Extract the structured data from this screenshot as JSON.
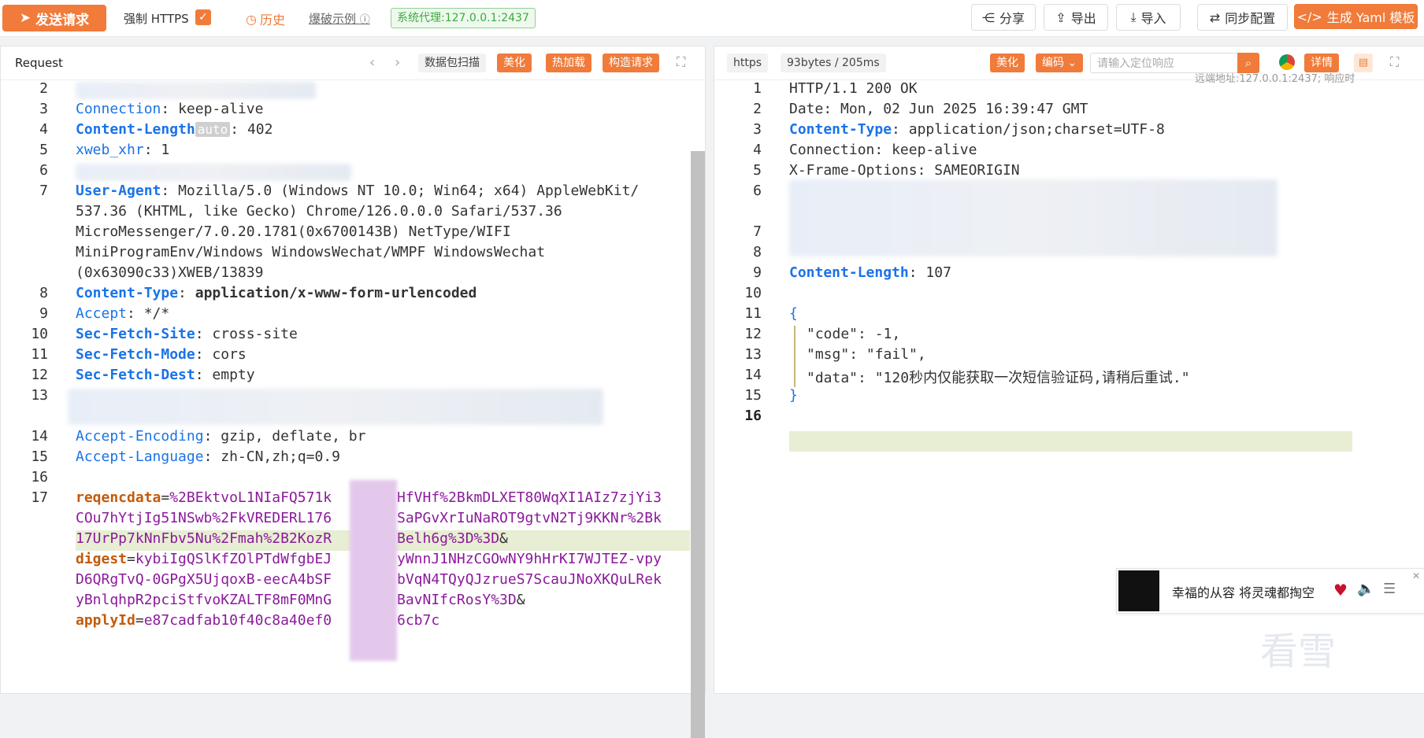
{
  "topbar": {
    "send_label": "发送请求",
    "https_label": "强制 HTTPS",
    "history_label": "历史",
    "example_label": "爆破示例",
    "proxy_label": "系统代理:127.0.0.1:2437",
    "share_label": "分享",
    "export_label": "导出",
    "import_label": "导入",
    "sync_label": "同步配置",
    "yaml_label": "生成 Yaml 模板"
  },
  "request": {
    "title": "Request",
    "scan_label": "数据包扫描",
    "beautify_label": "美化",
    "hotload_label": "热加载",
    "build_label": "构造请求",
    "auto_label": "auto",
    "line_numbers": [
      "2",
      "3",
      "4",
      "5",
      "6",
      "7",
      "8",
      "9",
      "10",
      "11",
      "12",
      "13",
      "14",
      "15",
      "16",
      "17"
    ],
    "headers": {
      "connection_key": "Connection",
      "connection_val": "keep-alive",
      "length_key": "Content-Length",
      "length_val": "402",
      "xhr_key": "xweb_xhr",
      "xhr_val": "1",
      "ua_key": "User-Agent",
      "ua_line1": "Mozilla/5.0 (Windows NT 10.0; Win64; x64) AppleWebKit/",
      "ua_line2": "537.36 (KHTML, like Gecko) Chrome/126.0.0.0 Safari/537.36",
      "ua_line3": "MicroMessenger/7.0.20.1781(0x6700143B) NetType/WIFI",
      "ua_line4": "MiniProgramEnv/Windows WindowsWechat/WMPF WindowsWechat",
      "ua_line5": "(0x63090c33)XWEB/13839",
      "ctype_key": "Content-Type",
      "ctype_val": "application/x-www-form-urlencoded",
      "accept_key": "Accept",
      "accept_val": "*/*",
      "site_key": "Sec-Fetch-Site",
      "site_val": "cross-site",
      "mode_key": "Sec-Fetch-Mode",
      "mode_val": "cors",
      "dest_key": "Sec-Fetch-Dest",
      "dest_val": "empty",
      "enc_key": "Accept-Encoding",
      "enc_val": "gzip, deflate, br",
      "lang_key": "Accept-Language",
      "lang_val": "zh-CN,zh;q=0.9"
    },
    "body": {
      "p1_key": "reqencdata",
      "p1_a1": "%2BEktvoL1NIaFQ571k",
      "p1_b1": "HfVHf%2BkmDLXET80WqXI1AIz7zjYi3",
      "p1_a2": "COu7hYtjIg51NSwb%2FkVREDERL176",
      "p1_b2": "SaPGvXrIuNaROT9gtvN2Tj9KKNr%2Bk",
      "p1_a3": "17UrPp7kNnFbv5Nu%2Fmah%2B2KozR",
      "p1_b3": "Belh6g%3D%3D",
      "p2_key": "digest",
      "p2_a1": "kybiIgQSlKfZOlPTdWfgbEJ",
      "p2_b1": "yWnnJ1NHzCGOwNY9hHrKI7WJTEZ-vpy",
      "p2_a2": "D6QRgTvQ-0GPgX5UjqoxB-eecA4bSF",
      "p2_b2": "bVqN4TQyQJzrueS7ScauJNoXKQuLRek",
      "p2_a3": "yBnlqhpR2pciStfvoKZALTF8mF0MnG",
      "p2_b3": "BavNIfcRosY%3D",
      "p3_key": "applyId",
      "p3_a1": "e87cadfab10f40c8a40ef0",
      "p3_b1": "6cb7c",
      "amp": "&"
    }
  },
  "response": {
    "scheme_label": "https",
    "size_label": "93bytes / 205ms",
    "beautify_label": "美化",
    "encode_label": "编码",
    "search_placeholder": "请输入定位响应",
    "detail_label": "详情",
    "remote_label": "远端地址:127.0.0.1:2437;  响应时",
    "line_numbers": [
      "1",
      "2",
      "3",
      "4",
      "5",
      "6",
      "7",
      "8",
      "9",
      "10",
      "11",
      "12",
      "13",
      "14",
      "15",
      "16"
    ],
    "status_line": "HTTP/1.1 200 OK",
    "date_key": "Date",
    "date_val": "Mon, 02 Jun 2025 16:39:47 GMT",
    "ctype_key": "Content-Type",
    "ctype_val": "application/json;charset=UTF-8",
    "conn_key": "Connection",
    "conn_val": "keep-alive",
    "xfo_key": "X-Frame-Options",
    "xfo_val": "SAMEORIGIN",
    "clen_key": "Content-Length",
    "clen_val": "107",
    "open_brace": "{",
    "close_brace": "}",
    "json_code_key": "\"code\"",
    "json_code_val": "-1,",
    "json_msg_key": "\"msg\"",
    "json_msg_val": "\"fail\",",
    "json_data_key": "\"data\"",
    "json_data_val": "\"120秒内仅能获取一次短信验证码,请稍后重试.\""
  },
  "music": {
    "title": "幸福的从容 将灵魂都掏空"
  },
  "watermark": "看雪"
}
